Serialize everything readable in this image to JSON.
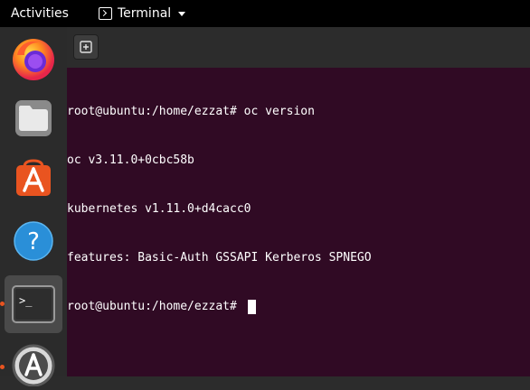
{
  "topbar": {
    "activities_label": "Activities",
    "app_menu_label": "Terminal",
    "app_menu_icon": "terminal-icon",
    "dropdown_icon": "caret-down-icon"
  },
  "dock": {
    "items": [
      {
        "name": "Firefox",
        "icon": "firefox-icon",
        "running": false,
        "active": false
      },
      {
        "name": "Files",
        "icon": "files-icon",
        "running": false,
        "active": false
      },
      {
        "name": "Ubuntu Software",
        "icon": "software-center-icon",
        "running": false,
        "active": false
      },
      {
        "name": "Help",
        "icon": "help-icon",
        "glyph": "?",
        "running": false,
        "active": false
      },
      {
        "name": "Terminal",
        "icon": "terminal-icon",
        "glyph": ">_",
        "running": true,
        "active": true
      },
      {
        "name": "Software Updater",
        "icon": "software-updater-icon",
        "running": true,
        "active": false
      }
    ]
  },
  "terminal": {
    "new_tab_icon": "new-tab-icon",
    "lines": [
      "root@ubuntu:/home/ezzat# oc version",
      "oc v3.11.0+0cbc58b",
      "kubernetes v1.11.0+d4cacc0",
      "features: Basic-Auth GSSAPI Kerberos SPNEGO"
    ],
    "prompt": "root@ubuntu:/home/ezzat# "
  },
  "colors": {
    "terminal_bg": "#300a24",
    "topbar_bg": "#000000",
    "dock_bg": "#2b2b2b",
    "accent": "#e95420"
  }
}
